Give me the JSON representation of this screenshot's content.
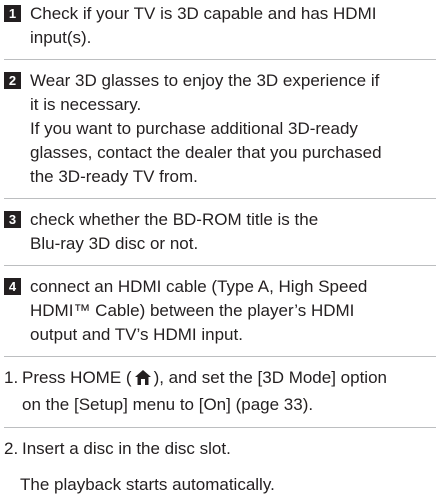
{
  "steps": [
    {
      "num": "1",
      "lines": [
        "Check if your TV is 3D capable and has HDMI",
        "input(s)."
      ]
    },
    {
      "num": "2",
      "lines": [
        "Wear 3D glasses to enjoy the 3D experience if",
        "it is necessary.",
        "If you want to purchase additional 3D-ready",
        "glasses, contact the dealer that you purchased",
        "the 3D-ready TV from."
      ]
    },
    {
      "num": "3",
      "lines": [
        "check whether the BD-ROM title is the",
        "Blu-ray 3D disc or not."
      ]
    },
    {
      "num": "4",
      "lines": [
        "connect an HDMI cable (Type A, High Speed",
        "HDMI™ Cable) between the player’s HDMI",
        "output and TV’s HDMI input."
      ]
    }
  ],
  "ordered": [
    {
      "num": "1.",
      "line1_pre": "Press HOME (",
      "line1_post": "), and set the [3D Mode] option",
      "line2": "on the [Setup] menu to [On] (page 33).",
      "icon": "home-icon"
    },
    {
      "num": "2.",
      "line1": "Insert a disc in the disc slot."
    }
  ],
  "result": "The playback starts automatically."
}
